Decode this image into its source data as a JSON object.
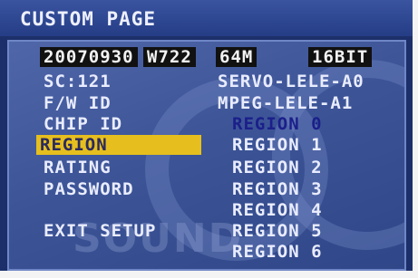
{
  "title": "CUSTOM PAGE",
  "info": {
    "date": "20070930",
    "model": "W722",
    "memory": "64M",
    "bits": "16BIT"
  },
  "fields": [
    {
      "label": "SC:121",
      "value": "SERVO-LELE-A0"
    },
    {
      "label": "F/W ID",
      "value": "MPEG-LELE-A1"
    },
    {
      "label": "CHIP ID",
      "value": ""
    }
  ],
  "menu": {
    "items": [
      "REGION",
      "RATING",
      "PASSWORD"
    ],
    "selected": "REGION",
    "exit": "EXIT SETUP"
  },
  "regions": {
    "current": "REGION 0",
    "options": [
      "REGION 1",
      "REGION 2",
      "REGION 3",
      "REGION 4",
      "REGION 5",
      "REGION 6"
    ]
  },
  "watermark": "SOUND",
  "colors": {
    "background": "#1d2f6a",
    "panel": "#3d5597",
    "highlight": "#e6bf1e",
    "current_region": "#1b1f8a",
    "text": "#e9ecff"
  }
}
